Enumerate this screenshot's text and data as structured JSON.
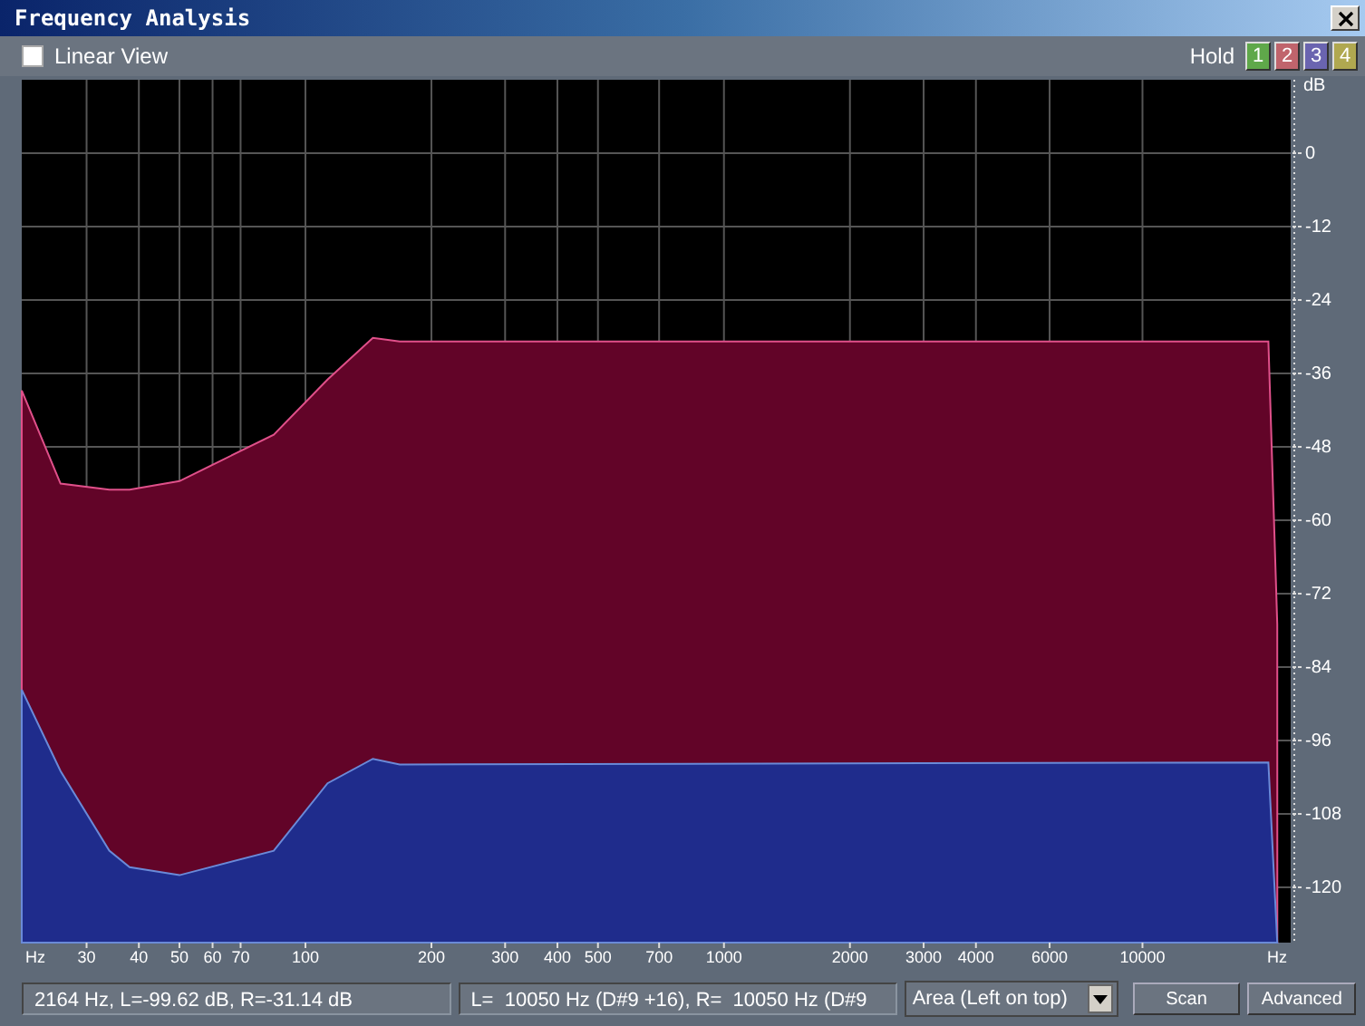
{
  "window": {
    "title": "Frequency Analysis"
  },
  "toolbar": {
    "linear_view": {
      "label": "Linear View",
      "checked": false
    },
    "hold_label": "Hold",
    "hold_buttons": [
      {
        "label": "1",
        "color": "#5fa84a"
      },
      {
        "label": "2",
        "color": "#c0646c"
      },
      {
        "label": "3",
        "color": "#6a64b0"
      },
      {
        "label": "4",
        "color": "#b0a850"
      }
    ]
  },
  "spectrum": {
    "y_unit": "dB",
    "y_labels": [
      "0",
      "-12",
      "-24",
      "-36",
      "-48",
      "-60",
      "-72",
      "-84",
      "-96",
      "-108",
      "-120"
    ],
    "x_unit": "Hz",
    "x_labels": [
      "30",
      "40",
      "50",
      "60",
      "70",
      "100",
      "200",
      "300",
      "400",
      "500",
      "700",
      "1000",
      "2000",
      "3000",
      "4000",
      "6000",
      "10000"
    ],
    "x_end_unit": "Hz"
  },
  "status": {
    "cursor": "2164 Hz, L=-99.62 dB, R=-31.14 dB",
    "peak": "L=  10050 Hz (D#9 +16), R=  10050 Hz (D#9"
  },
  "display_mode": "Area (Left on top)",
  "buttons": [
    "Scan",
    "Advanced"
  ]
}
